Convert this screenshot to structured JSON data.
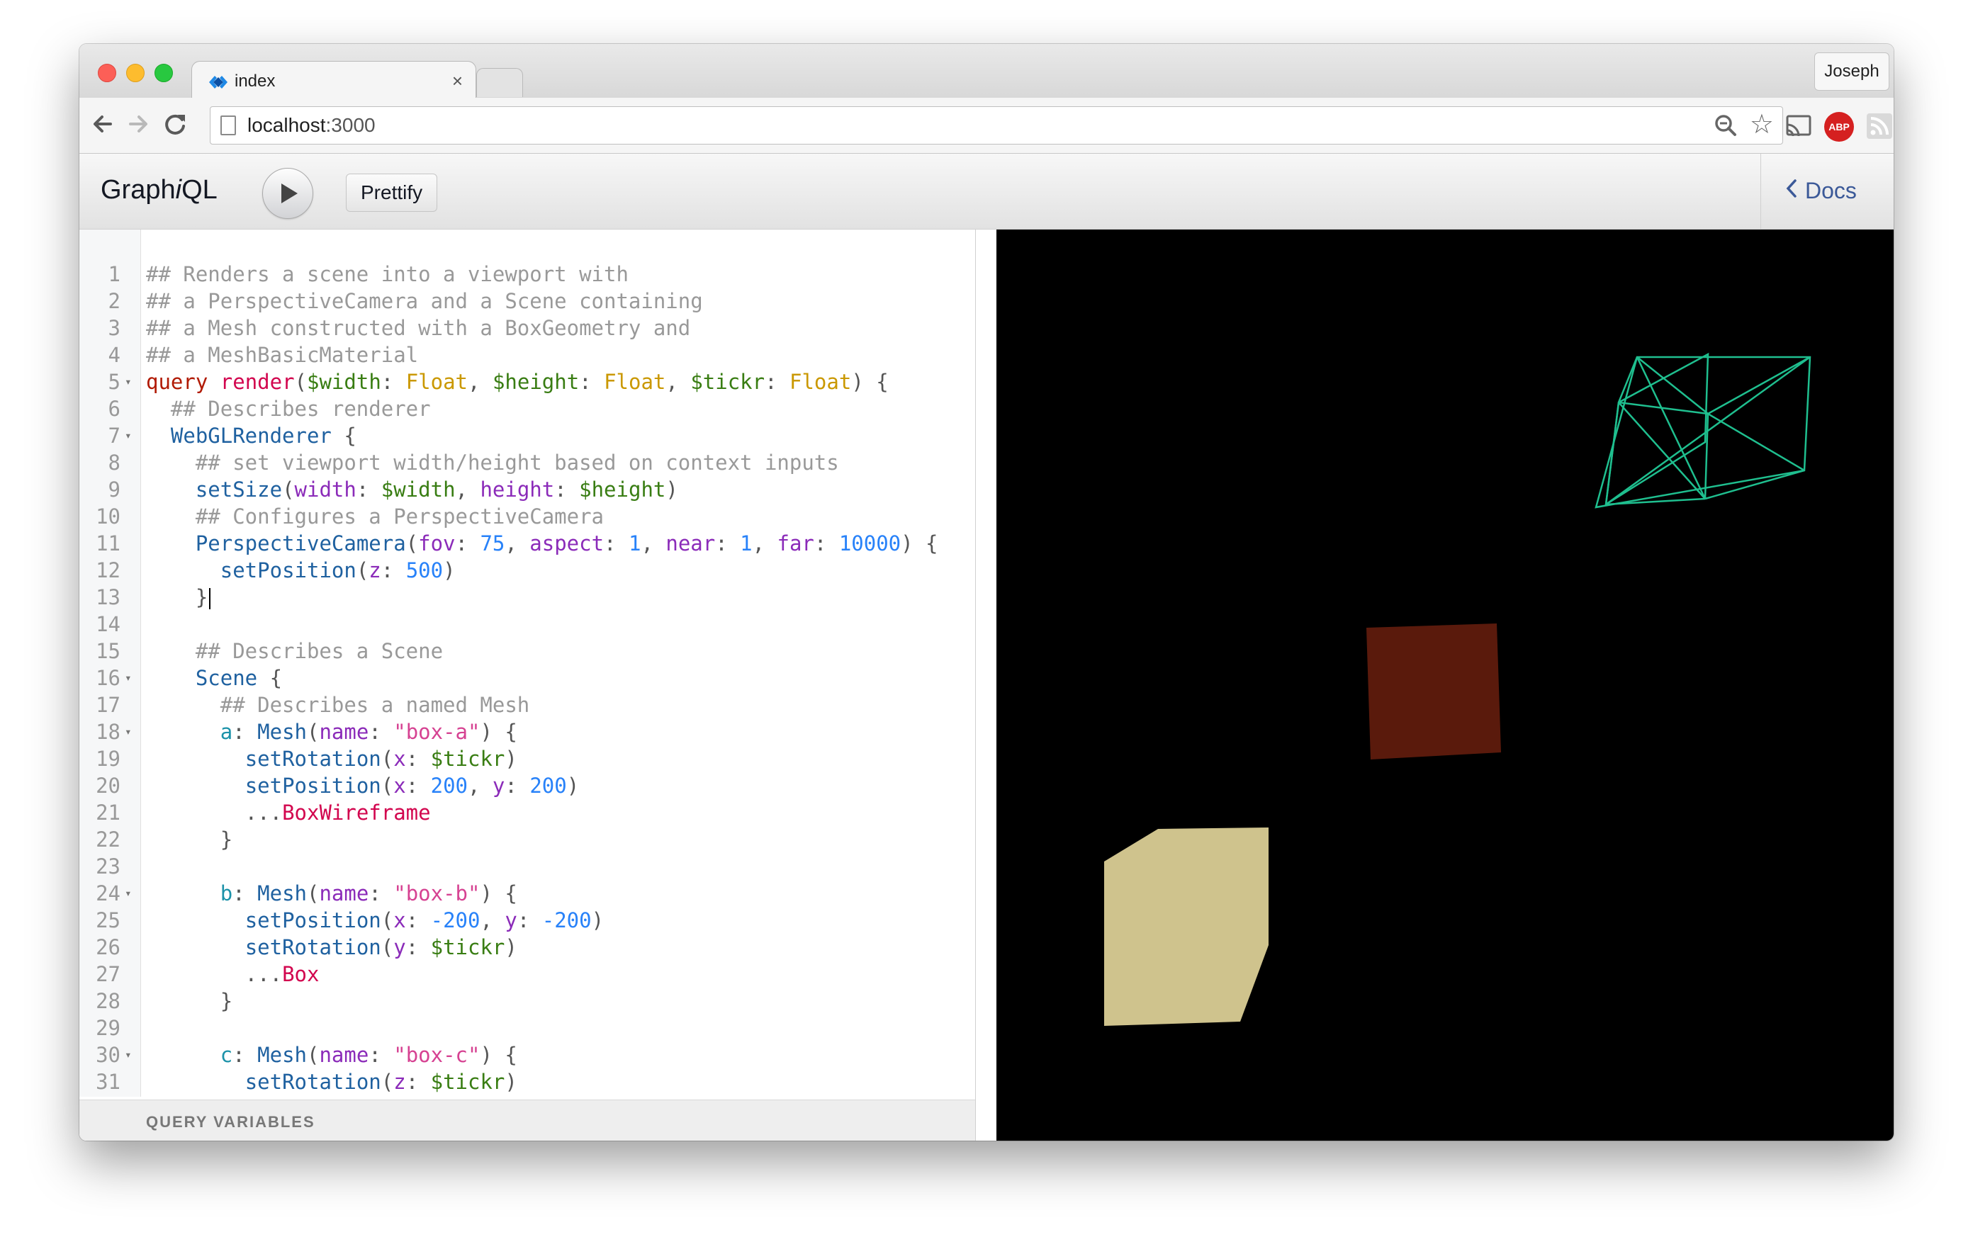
{
  "browser": {
    "tab_title": "index",
    "tab_close": "×",
    "profile_name": "Joseph",
    "url_host": "localhost",
    "url_port": ":3000",
    "abp_label": "ABP"
  },
  "graphiql": {
    "title_pre": "Graph",
    "title_i": "i",
    "title_post": "QL",
    "prettify_label": "Prettify",
    "docs_label": "Docs",
    "query_variables_label": "QUERY VARIABLES"
  },
  "editor": {
    "lines": [
      {
        "n": "1",
        "fold": false,
        "tokens": [
          {
            "t": "## Renders a scene into a viewport with",
            "c": "comment"
          }
        ]
      },
      {
        "n": "2",
        "fold": false,
        "tokens": [
          {
            "t": "## a PerspectiveCamera and a Scene containing",
            "c": "comment"
          }
        ]
      },
      {
        "n": "3",
        "fold": false,
        "tokens": [
          {
            "t": "## a Mesh constructed with a BoxGeometry and",
            "c": "comment"
          }
        ]
      },
      {
        "n": "4",
        "fold": false,
        "tokens": [
          {
            "t": "## a MeshBasicMaterial",
            "c": "comment"
          }
        ]
      },
      {
        "n": "5",
        "fold": true,
        "tokens": [
          {
            "t": "query",
            "c": "keyword"
          },
          {
            "t": " ",
            "c": "punct"
          },
          {
            "t": "render",
            "c": "def"
          },
          {
            "t": "(",
            "c": "punct"
          },
          {
            "t": "$width",
            "c": "var"
          },
          {
            "t": ": ",
            "c": "punct"
          },
          {
            "t": "Float",
            "c": "type"
          },
          {
            "t": ", ",
            "c": "punct"
          },
          {
            "t": "$height",
            "c": "var"
          },
          {
            "t": ": ",
            "c": "punct"
          },
          {
            "t": "Float",
            "c": "type"
          },
          {
            "t": ", ",
            "c": "punct"
          },
          {
            "t": "$tickr",
            "c": "var"
          },
          {
            "t": ": ",
            "c": "punct"
          },
          {
            "t": "Float",
            "c": "type"
          },
          {
            "t": ") {",
            "c": "punct"
          }
        ]
      },
      {
        "n": "6",
        "fold": false,
        "tokens": [
          {
            "t": "  ## Describes renderer",
            "c": "comment"
          }
        ]
      },
      {
        "n": "7",
        "fold": true,
        "tokens": [
          {
            "t": "  ",
            "c": "punct"
          },
          {
            "t": "WebGLRenderer",
            "c": "property"
          },
          {
            "t": " {",
            "c": "punct"
          }
        ]
      },
      {
        "n": "8",
        "fold": false,
        "tokens": [
          {
            "t": "    ## set viewport width/height based on context inputs",
            "c": "comment"
          }
        ]
      },
      {
        "n": "9",
        "fold": false,
        "tokens": [
          {
            "t": "    ",
            "c": "punct"
          },
          {
            "t": "setSize",
            "c": "property"
          },
          {
            "t": "(",
            "c": "punct"
          },
          {
            "t": "width",
            "c": "attr"
          },
          {
            "t": ": ",
            "c": "punct"
          },
          {
            "t": "$width",
            "c": "var"
          },
          {
            "t": ", ",
            "c": "punct"
          },
          {
            "t": "height",
            "c": "attr"
          },
          {
            "t": ": ",
            "c": "punct"
          },
          {
            "t": "$height",
            "c": "var"
          },
          {
            "t": ")",
            "c": "punct"
          }
        ]
      },
      {
        "n": "10",
        "fold": false,
        "tokens": [
          {
            "t": "    ## Configures a PerspectiveCamera",
            "c": "comment"
          }
        ]
      },
      {
        "n": "11",
        "fold": false,
        "tokens": [
          {
            "t": "    ",
            "c": "punct"
          },
          {
            "t": "PerspectiveCamera",
            "c": "property"
          },
          {
            "t": "(",
            "c": "punct"
          },
          {
            "t": "fov",
            "c": "attr"
          },
          {
            "t": ": ",
            "c": "punct"
          },
          {
            "t": "75",
            "c": "number"
          },
          {
            "t": ", ",
            "c": "punct"
          },
          {
            "t": "aspect",
            "c": "attr"
          },
          {
            "t": ": ",
            "c": "punct"
          },
          {
            "t": "1",
            "c": "number"
          },
          {
            "t": ", ",
            "c": "punct"
          },
          {
            "t": "near",
            "c": "attr"
          },
          {
            "t": ": ",
            "c": "punct"
          },
          {
            "t": "1",
            "c": "number"
          },
          {
            "t": ", ",
            "c": "punct"
          },
          {
            "t": "far",
            "c": "attr"
          },
          {
            "t": ": ",
            "c": "punct"
          },
          {
            "t": "10000",
            "c": "number"
          },
          {
            "t": ") {",
            "c": "punct"
          }
        ]
      },
      {
        "n": "12",
        "fold": false,
        "tokens": [
          {
            "t": "      ",
            "c": "punct"
          },
          {
            "t": "setPosition",
            "c": "property"
          },
          {
            "t": "(",
            "c": "punct"
          },
          {
            "t": "z",
            "c": "attr"
          },
          {
            "t": ": ",
            "c": "punct"
          },
          {
            "t": "500",
            "c": "number"
          },
          {
            "t": ")",
            "c": "punct"
          }
        ]
      },
      {
        "n": "13",
        "fold": false,
        "cursor": true,
        "tokens": [
          {
            "t": "    }",
            "c": "punct"
          }
        ]
      },
      {
        "n": "14",
        "fold": false,
        "tokens": []
      },
      {
        "n": "15",
        "fold": false,
        "tokens": [
          {
            "t": "    ## Describes a Scene",
            "c": "comment"
          }
        ]
      },
      {
        "n": "16",
        "fold": true,
        "tokens": [
          {
            "t": "    ",
            "c": "punct"
          },
          {
            "t": "Scene",
            "c": "property"
          },
          {
            "t": " {",
            "c": "punct"
          }
        ]
      },
      {
        "n": "17",
        "fold": false,
        "tokens": [
          {
            "t": "      ## Describes a named Mesh",
            "c": "comment"
          }
        ]
      },
      {
        "n": "18",
        "fold": true,
        "tokens": [
          {
            "t": "      ",
            "c": "punct"
          },
          {
            "t": "a",
            "c": "alias"
          },
          {
            "t": ": ",
            "c": "punct"
          },
          {
            "t": "Mesh",
            "c": "property"
          },
          {
            "t": "(",
            "c": "punct"
          },
          {
            "t": "name",
            "c": "attr"
          },
          {
            "t": ": ",
            "c": "punct"
          },
          {
            "t": "\"box-a\"",
            "c": "string"
          },
          {
            "t": ") {",
            "c": "punct"
          }
        ]
      },
      {
        "n": "19",
        "fold": false,
        "tokens": [
          {
            "t": "        ",
            "c": "punct"
          },
          {
            "t": "setRotation",
            "c": "property"
          },
          {
            "t": "(",
            "c": "punct"
          },
          {
            "t": "x",
            "c": "attr"
          },
          {
            "t": ": ",
            "c": "punct"
          },
          {
            "t": "$tickr",
            "c": "var"
          },
          {
            "t": ")",
            "c": "punct"
          }
        ]
      },
      {
        "n": "20",
        "fold": false,
        "tokens": [
          {
            "t": "        ",
            "c": "punct"
          },
          {
            "t": "setPosition",
            "c": "property"
          },
          {
            "t": "(",
            "c": "punct"
          },
          {
            "t": "x",
            "c": "attr"
          },
          {
            "t": ": ",
            "c": "punct"
          },
          {
            "t": "200",
            "c": "number"
          },
          {
            "t": ", ",
            "c": "punct"
          },
          {
            "t": "y",
            "c": "attr"
          },
          {
            "t": ": ",
            "c": "punct"
          },
          {
            "t": "200",
            "c": "number"
          },
          {
            "t": ")",
            "c": "punct"
          }
        ]
      },
      {
        "n": "21",
        "fold": false,
        "tokens": [
          {
            "t": "        ...",
            "c": "punct"
          },
          {
            "t": "BoxWireframe",
            "c": "def"
          }
        ]
      },
      {
        "n": "22",
        "fold": false,
        "tokens": [
          {
            "t": "      }",
            "c": "punct"
          }
        ]
      },
      {
        "n": "23",
        "fold": false,
        "tokens": []
      },
      {
        "n": "24",
        "fold": true,
        "tokens": [
          {
            "t": "      ",
            "c": "punct"
          },
          {
            "t": "b",
            "c": "alias"
          },
          {
            "t": ": ",
            "c": "punct"
          },
          {
            "t": "Mesh",
            "c": "property"
          },
          {
            "t": "(",
            "c": "punct"
          },
          {
            "t": "name",
            "c": "attr"
          },
          {
            "t": ": ",
            "c": "punct"
          },
          {
            "t": "\"box-b\"",
            "c": "string"
          },
          {
            "t": ") {",
            "c": "punct"
          }
        ]
      },
      {
        "n": "25",
        "fold": false,
        "tokens": [
          {
            "t": "        ",
            "c": "punct"
          },
          {
            "t": "setPosition",
            "c": "property"
          },
          {
            "t": "(",
            "c": "punct"
          },
          {
            "t": "x",
            "c": "attr"
          },
          {
            "t": ": ",
            "c": "punct"
          },
          {
            "t": "-200",
            "c": "number"
          },
          {
            "t": ", ",
            "c": "punct"
          },
          {
            "t": "y",
            "c": "attr"
          },
          {
            "t": ": ",
            "c": "punct"
          },
          {
            "t": "-200",
            "c": "number"
          },
          {
            "t": ")",
            "c": "punct"
          }
        ]
      },
      {
        "n": "26",
        "fold": false,
        "tokens": [
          {
            "t": "        ",
            "c": "punct"
          },
          {
            "t": "setRotation",
            "c": "property"
          },
          {
            "t": "(",
            "c": "punct"
          },
          {
            "t": "y",
            "c": "attr"
          },
          {
            "t": ": ",
            "c": "punct"
          },
          {
            "t": "$tickr",
            "c": "var"
          },
          {
            "t": ")",
            "c": "punct"
          }
        ]
      },
      {
        "n": "27",
        "fold": false,
        "tokens": [
          {
            "t": "        ...",
            "c": "punct"
          },
          {
            "t": "Box",
            "c": "def"
          }
        ]
      },
      {
        "n": "28",
        "fold": false,
        "tokens": [
          {
            "t": "      }",
            "c": "punct"
          }
        ]
      },
      {
        "n": "29",
        "fold": false,
        "tokens": []
      },
      {
        "n": "30",
        "fold": true,
        "tokens": [
          {
            "t": "      ",
            "c": "punct"
          },
          {
            "t": "c",
            "c": "alias"
          },
          {
            "t": ": ",
            "c": "punct"
          },
          {
            "t": "Mesh",
            "c": "property"
          },
          {
            "t": "(",
            "c": "punct"
          },
          {
            "t": "name",
            "c": "attr"
          },
          {
            "t": ": ",
            "c": "punct"
          },
          {
            "t": "\"box-c\"",
            "c": "string"
          },
          {
            "t": ") {",
            "c": "punct"
          }
        ]
      },
      {
        "n": "31",
        "fold": false,
        "tokens": [
          {
            "t": "        ",
            "c": "punct"
          },
          {
            "t": "setRotation",
            "c": "property"
          },
          {
            "t": "(",
            "c": "punct"
          },
          {
            "t": "z",
            "c": "attr"
          },
          {
            "t": ": ",
            "c": "punct"
          },
          {
            "t": "$tickr",
            "c": "var"
          },
          {
            "t": ")",
            "c": "punct"
          }
        ]
      }
    ]
  },
  "viewport": {
    "background": "#000000",
    "wireframe_color": "#1fbf8f",
    "red_box_color": "#5a1a0c",
    "tan_box_color": "#cfc38d"
  },
  "colors": {
    "docs_link": "#3b5998"
  }
}
